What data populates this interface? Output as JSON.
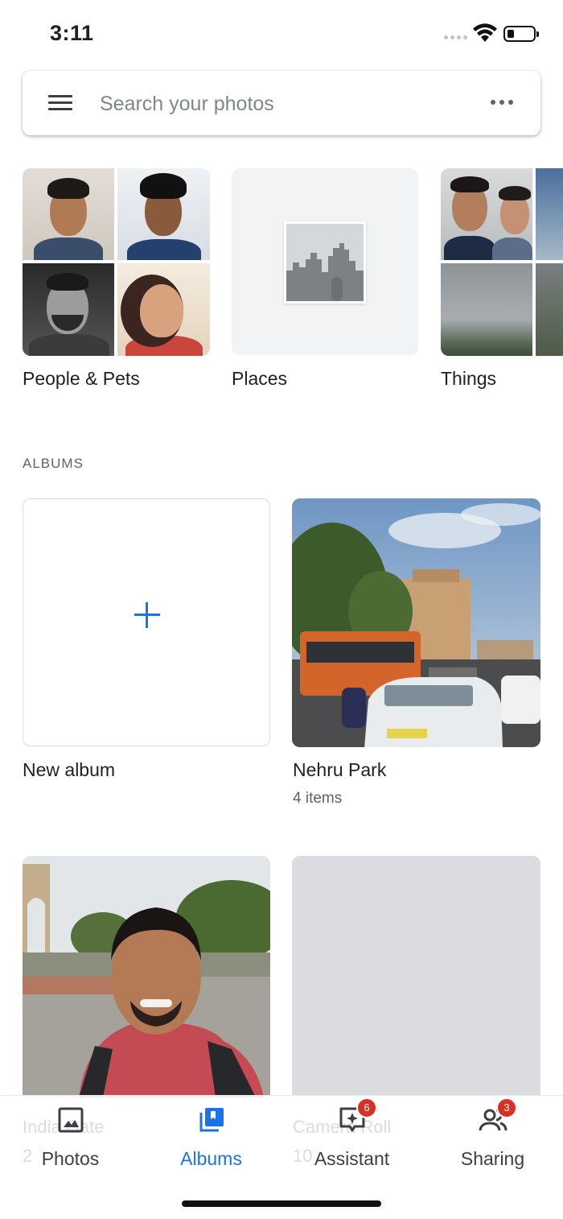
{
  "status_bar": {
    "time": "3:11"
  },
  "search": {
    "placeholder": "Search your photos"
  },
  "explore": {
    "people_label": "People & Pets",
    "places_label": "Places",
    "things_label": "Things"
  },
  "albums": {
    "section_title": "ALBUMS",
    "new_album_label": "New album",
    "items": [
      {
        "title": "Nehru Park",
        "subtitle": "4 items"
      },
      {
        "title": "India Gate",
        "subtitle": "2"
      },
      {
        "title": "Camera Roll",
        "subtitle": "10"
      }
    ]
  },
  "nav": {
    "photos": "Photos",
    "albums": "Albums",
    "assistant": "Assistant",
    "assistant_badge": "6",
    "sharing": "Sharing",
    "sharing_badge": "3"
  },
  "colors": {
    "accent": "#1a73e8",
    "badge": "#d93025"
  }
}
